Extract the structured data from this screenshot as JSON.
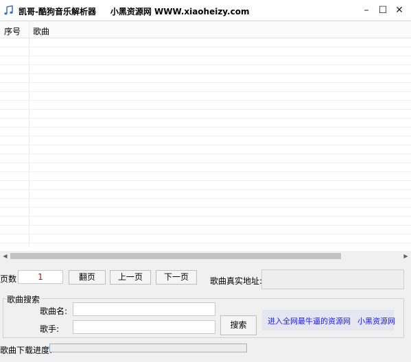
{
  "window": {
    "title": "凯哥-酷狗音乐解析器     小黑资源网 WWW.xiaoheizy.com",
    "minimize": "–",
    "maximize": "☐",
    "close": "✕"
  },
  "song_list": {
    "columns": [
      "序号",
      "歌曲"
    ],
    "rows": []
  },
  "paging": {
    "page_label": "页数",
    "page_value": "1",
    "flip_label": "翻页",
    "prev_label": "上一页",
    "next_label": "下一页"
  },
  "real_address": {
    "label": "歌曲真实地址:",
    "value": ""
  },
  "search": {
    "group_title": "歌曲搜索",
    "song_name_label": "歌曲名:",
    "song_name_value": "",
    "singer_label": "歌手:",
    "singer_value": "",
    "search_button": "搜索"
  },
  "links": {
    "text1": "进入全网最牛逼的资源网",
    "text2": "小黑资源网"
  },
  "download": {
    "label": "歌曲下载进度:",
    "progress": 0
  },
  "colors": {
    "link": "#1a1aff",
    "page_value": "#d00000"
  }
}
